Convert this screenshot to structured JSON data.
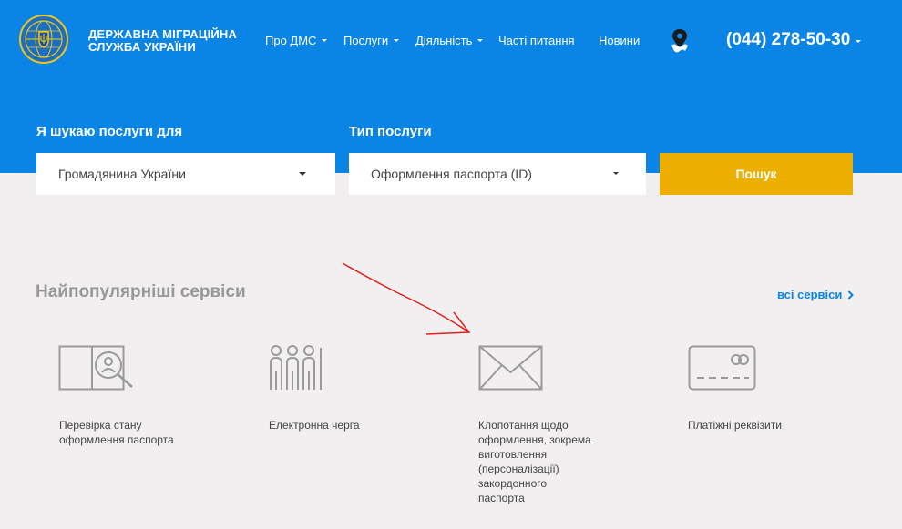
{
  "header": {
    "org_name_line1": "ДЕРЖАВНА МІГРАЦІЙНА",
    "org_name_line2": "СЛУЖБА УКРАЇНИ",
    "nav": [
      {
        "label": "Про ДМС"
      },
      {
        "label": "Послуги"
      },
      {
        "label": "Діяльність"
      },
      {
        "label": "Часті питання"
      },
      {
        "label": "Новини"
      }
    ],
    "phone": "(044) 278-50-30",
    "background_color": "#0a85e6"
  },
  "search": {
    "label_for": "Я шукаю послуги для",
    "label_type": "Тип послуги",
    "for_value": "Громадянина України",
    "type_value": "Оформлення паспорта (ID)",
    "button_label": "Пошук",
    "button_color": "#edaf01"
  },
  "services": {
    "title": "Найпопулярніші сервіси",
    "all_link": "всі сервіси",
    "items": [
      {
        "icon": "passport-search-icon",
        "label_lines": [
          "Перевірка стану",
          "оформлення паспорта"
        ]
      },
      {
        "icon": "queue-people-icon",
        "label_lines": [
          "Електронна черга"
        ]
      },
      {
        "icon": "envelope-icon",
        "label_lines": [
          "Клопотання щодо",
          "оформлення, зокрема",
          "виготовлення",
          "(персоналізації)",
          "закордонного",
          "паспорта"
        ]
      },
      {
        "icon": "payment-card-icon",
        "label_lines": [
          "Платіжні реквізити"
        ]
      }
    ]
  }
}
